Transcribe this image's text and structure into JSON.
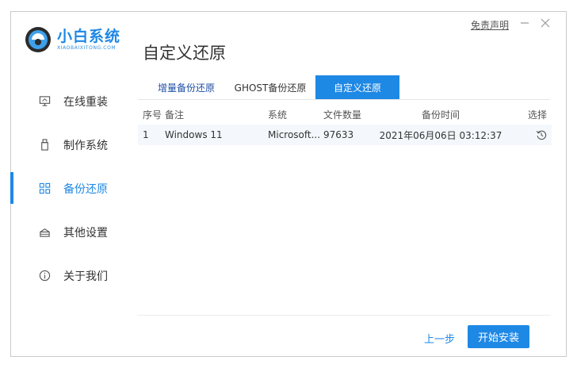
{
  "app": {
    "logo_title": "小白系统",
    "logo_subtitle": "XIAOBAIXITONG.COM",
    "page_title": "自定义还原",
    "disclaimer": "免责声明",
    "brand_color": "#1e88e5"
  },
  "sidebar": {
    "items": [
      {
        "label": "在线重装",
        "icon": "monitor-icon"
      },
      {
        "label": "制作系统",
        "icon": "usb-icon"
      },
      {
        "label": "备份还原",
        "icon": "grid-icon",
        "active": true
      },
      {
        "label": "其他设置",
        "icon": "layers-icon"
      },
      {
        "label": "关于我们",
        "icon": "info-icon"
      }
    ]
  },
  "tabs": [
    {
      "label": "增量备份还原"
    },
    {
      "label": "GHOST备份还原"
    },
    {
      "label": "自定义还原",
      "active": true
    }
  ],
  "table": {
    "headers": {
      "no": "序号",
      "note": "备注",
      "system": "系统",
      "files": "文件数量",
      "time": "备份时间",
      "select": "选择"
    },
    "rows": [
      {
        "no": "1",
        "note": "Windows 11",
        "system": "Microsoft...",
        "files": "97633",
        "time": "2021年06月06日 03:12:37",
        "select_icon": "restore-icon"
      }
    ]
  },
  "footer": {
    "prev_label": "上一步",
    "install_label": "开始安装"
  }
}
